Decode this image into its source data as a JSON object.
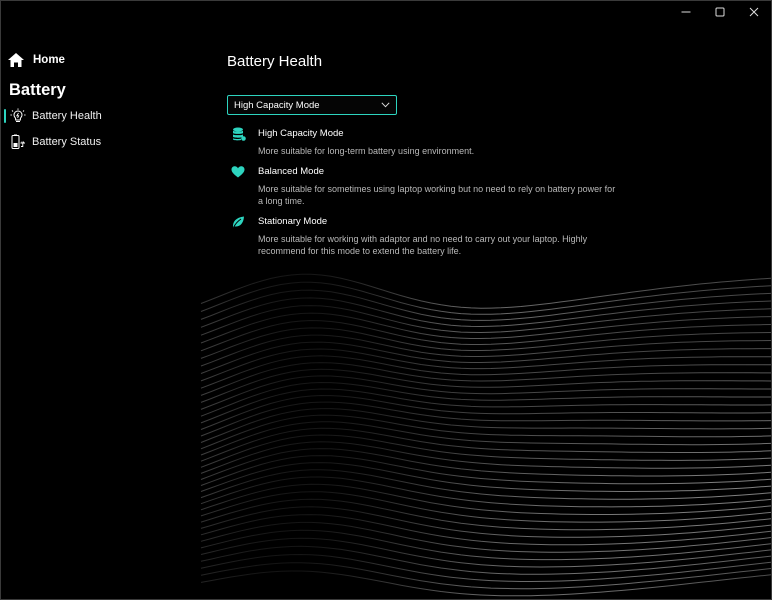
{
  "window": {
    "controls": {
      "minimize": "minimize-icon",
      "maximize": "maximize-icon",
      "close": "close-icon"
    }
  },
  "sidebar": {
    "home": {
      "label": "Home",
      "icon": "home-icon"
    },
    "section_title": "Battery",
    "items": [
      {
        "label": "Battery Health",
        "icon": "battery-health-icon",
        "active": true
      },
      {
        "label": "Battery Status",
        "icon": "battery-status-icon",
        "active": false
      }
    ]
  },
  "main": {
    "title": "Battery Health",
    "mode_select": {
      "selected": "High Capacity Mode",
      "icon": "chevron-down-icon"
    },
    "modes": [
      {
        "name": "High Capacity Mode",
        "icon": "database-icon",
        "description": "More suitable for long-term battery using environment."
      },
      {
        "name": "Balanced Mode",
        "icon": "heart-icon",
        "description": "More suitable for sometimes using laptop working but no need to rely on battery power for a long time."
      },
      {
        "name": "Stationary Mode",
        "icon": "leaf-icon",
        "description": "More suitable for working with adaptor and no need to carry out your laptop. Highly recommend for this mode to extend the battery life."
      }
    ]
  },
  "colors": {
    "accent": "#2dd4bf",
    "background": "#000000",
    "text": "#ffffff",
    "muted_text": "#b9b9b9"
  }
}
